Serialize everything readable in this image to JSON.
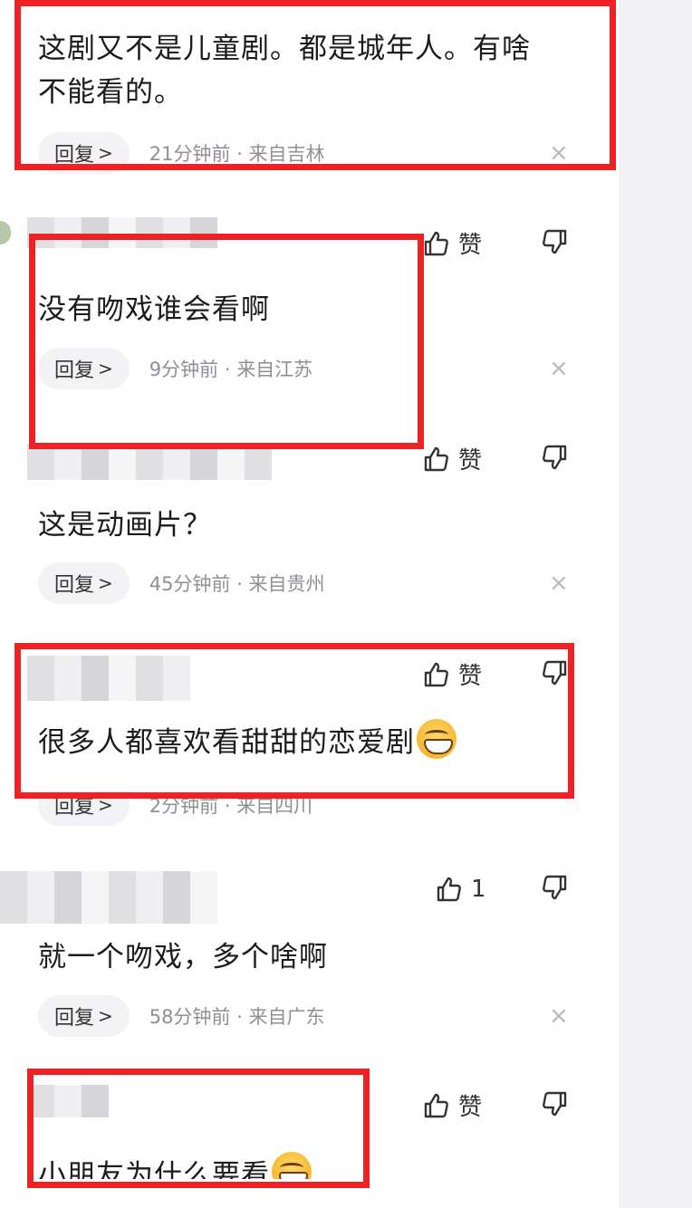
{
  "comments": [
    {
      "text": "这剧又不是儿童剧。都是城年人。有啥\n不能看的。",
      "reply_label": "回复",
      "reply_chevron": ">",
      "time": "21分钟前",
      "location": "来自吉林",
      "close": "×"
    },
    {
      "like_label": "赞",
      "text": "没有吻戏谁会看啊",
      "reply_label": "回复",
      "reply_chevron": ">",
      "time": "9分钟前",
      "location": "来自江苏",
      "close": "×"
    },
    {
      "like_label": "赞",
      "text": "这是动画片？",
      "reply_label": "回复",
      "reply_chevron": ">",
      "time": "45分钟前",
      "location": "来自贵州",
      "close": "×"
    },
    {
      "like_label": "赞",
      "text": "很多人都喜欢看甜甜的恋爱剧",
      "emoji": "grinning-face-emoji",
      "reply_label": "回复",
      "reply_chevron": ">",
      "time": "2分钟前",
      "location": "来自四川"
    },
    {
      "like_label": "1",
      "text": "就一个吻戏，多个啥啊",
      "reply_label": "回复",
      "reply_chevron": ">",
      "time": "58分钟前",
      "location": "来自广东",
      "close": "×"
    },
    {
      "like_label": "赞",
      "text": "小朋友为什么要看",
      "emoji": "laughing-face-emoji"
    }
  ],
  "separator": " · ",
  "icons": {
    "like": "thumbs-up-icon",
    "dislike": "thumbs-down-icon",
    "close": "close-icon"
  },
  "colors": {
    "highlight_box": "#ee2225",
    "meta_text": "#8f8f96",
    "reply_pill_bg": "#f3f3f6",
    "side_strip": "#f1f1f3"
  }
}
